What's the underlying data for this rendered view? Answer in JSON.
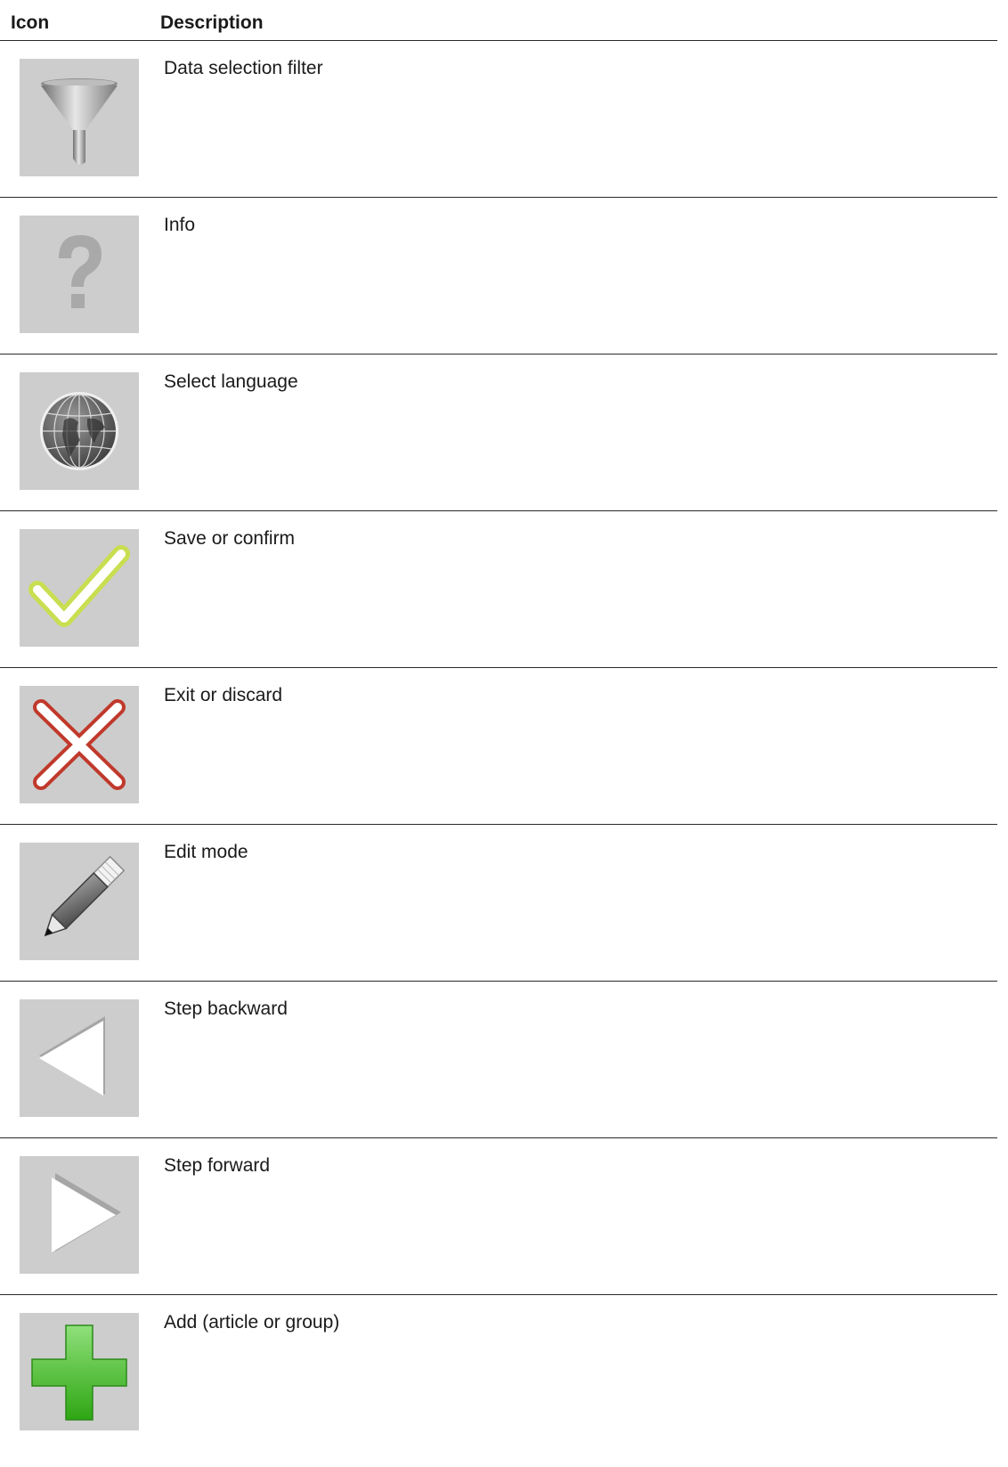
{
  "table": {
    "header": {
      "icon": "Icon",
      "description": "Description"
    },
    "rows": [
      {
        "icon": "funnel-icon",
        "description": "Data selection filter"
      },
      {
        "icon": "question-mark-icon",
        "description": "Info"
      },
      {
        "icon": "globe-icon",
        "description": "Select language"
      },
      {
        "icon": "checkmark-icon",
        "description": "Save or confirm"
      },
      {
        "icon": "cross-icon",
        "description": "Exit or discard"
      },
      {
        "icon": "pencil-icon",
        "description": "Edit mode"
      },
      {
        "icon": "triangle-left-icon",
        "description": "Step backward"
      },
      {
        "icon": "triangle-right-icon",
        "description": "Step forward"
      },
      {
        "icon": "plus-icon",
        "description": "Add (article or group)"
      }
    ]
  },
  "colors": {
    "tile_background": "#cdcdcd",
    "check_accent": "#c8e03a",
    "cross_accent": "#c0392b",
    "plus_accent": "#3ec41f",
    "rule": "#2a2a2a"
  }
}
